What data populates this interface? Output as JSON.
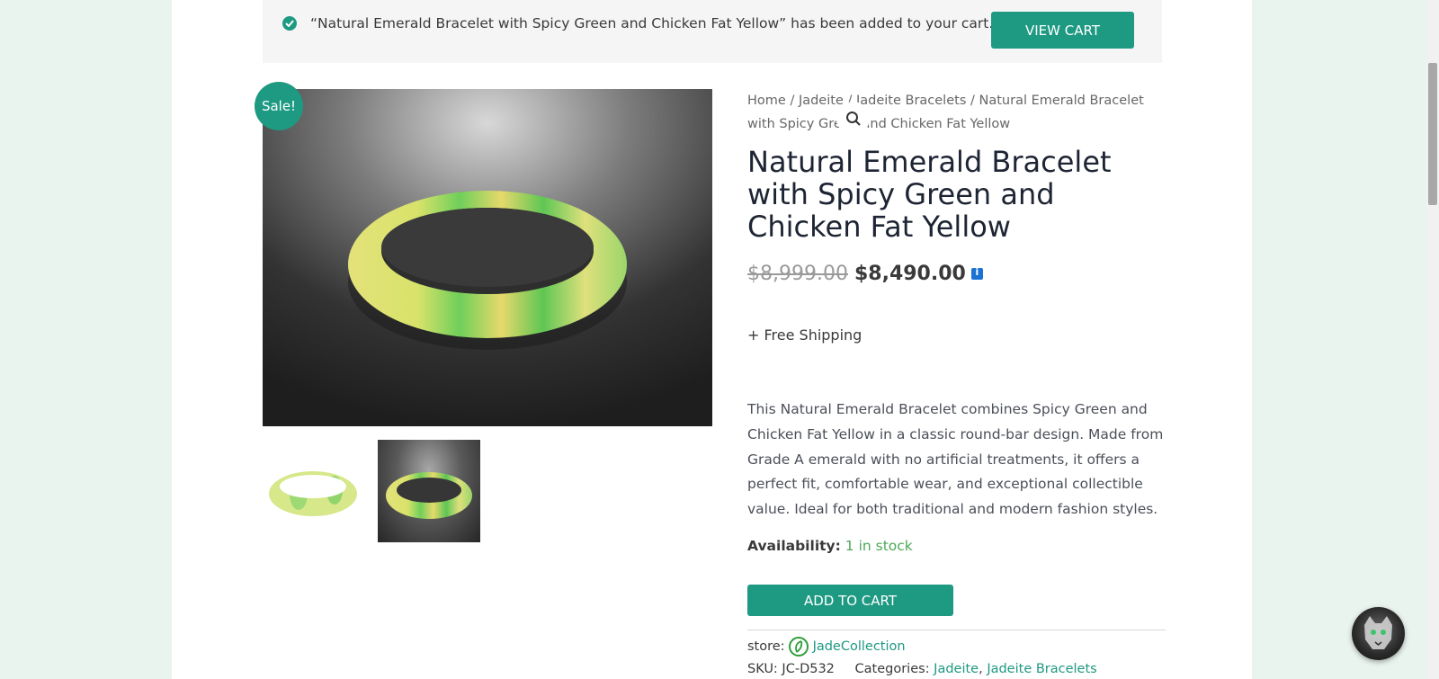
{
  "notice": {
    "message": "“Natural Emerald Bracelet with Spicy Green and Chicken Fat Yellow” has been added to your cart.",
    "view_cart_label": "VIEW CART"
  },
  "gallery": {
    "sale_badge": "Sale!",
    "zoom_icon": "search-icon"
  },
  "breadcrumb": {
    "items": [
      "Home",
      "Jadeite",
      "Jadeite Bracelets"
    ],
    "separator": "/",
    "current": "Natural Emerald Bracelet with Spicy Green and Chicken Fat Yellow"
  },
  "product": {
    "title": "Natural Emerald Bracelet with Spicy Green and Chicken Fat Yellow",
    "old_price": "$8,999.00",
    "new_price": "$8,490.00",
    "shipping": "+ Free Shipping",
    "description": "This Natural Emerald Bracelet combines Spicy Green and Chicken Fat Yellow in a classic round-bar design. Made from Grade A emerald with no artificial treatments, it offers a perfect fit, comfortable wear, and exceptional collectible value. Ideal for both traditional and modern fashion styles.",
    "availability_label": "Availability:",
    "availability_value": "1 in stock",
    "add_to_cart_label": "ADD TO CART",
    "store_label": "store:",
    "store_name": "JadeCollection",
    "sku": "SKU: JC-D532",
    "categories_label": "Categories:",
    "categories": [
      "Jadeite",
      "Jadeite Bracelets"
    ]
  },
  "colors": {
    "accent": "#1e9982",
    "stock": "#4fa85a",
    "page_bg": "#eaf4ee"
  }
}
